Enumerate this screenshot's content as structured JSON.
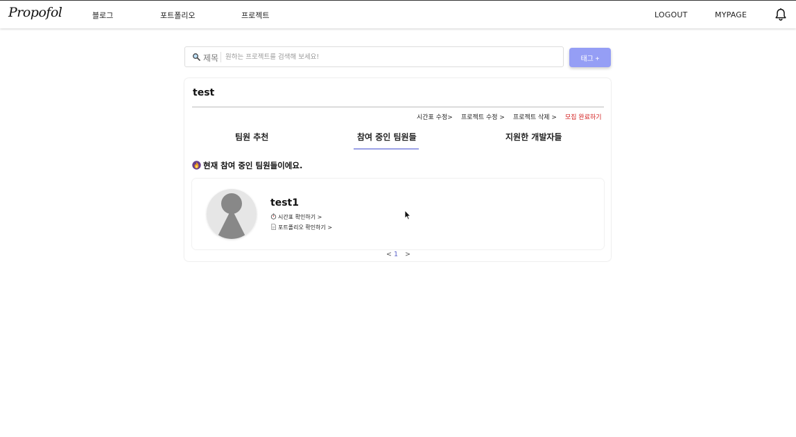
{
  "header": {
    "logo": "Propofol",
    "nav": [
      "블로그",
      "포트폴리오",
      "프로젝트"
    ],
    "logout": "LOGOUT",
    "mypage": "MYPAGE"
  },
  "search": {
    "category": "제목",
    "placeholder": "원하는 프로젝트를 검색해 보세요!",
    "tag_button": "태그 +"
  },
  "project": {
    "title": "test",
    "actions": [
      "시간표 수정>",
      "프로젝트 수정 >",
      "프로젝트 삭제 >",
      "모집 완료하기"
    ],
    "tabs": [
      "팀원 추천",
      "참여 중인 팀원들",
      "지원한 개발자들"
    ],
    "active_tab": "참여 중인 팀원들",
    "section_heading": "현재 참여 중인 팀원들이에요.",
    "members": [
      {
        "name": "test1",
        "timetable_link": "시간표 확인하기 >",
        "portfolio_link": "포트폴리오 확인하기 >"
      }
    ],
    "pagination": {
      "prev": "<",
      "current": "1",
      "next": ">"
    }
  },
  "colors": {
    "accent": "#959ef5",
    "tab_underline": "#9aa0e6",
    "danger": "#d32020"
  },
  "icons": {
    "search": "magnifier-icon",
    "bell": "bell-icon",
    "section": "fire-icon",
    "timetable": "stopwatch-icon",
    "portfolio": "document-icon"
  }
}
